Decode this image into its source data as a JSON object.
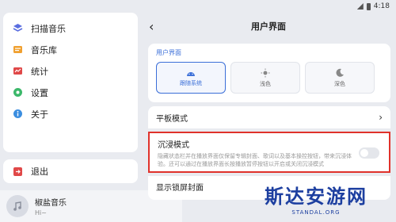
{
  "status_bar": {
    "time": "4:18"
  },
  "sidebar": {
    "items": [
      {
        "label": "扫描音乐",
        "icon": "scan-icon"
      },
      {
        "label": "音乐库",
        "icon": "library-icon"
      },
      {
        "label": "统计",
        "icon": "stats-icon"
      },
      {
        "label": "设置",
        "icon": "gear-icon"
      },
      {
        "label": "关于",
        "icon": "info-icon"
      }
    ],
    "exit_label": "退出"
  },
  "player": {
    "title": "椒盐音乐",
    "subtitle": "Hi~"
  },
  "header": {
    "title": "用户界面"
  },
  "theme_section": {
    "label": "用户界面",
    "options": [
      {
        "label": "跟随系统",
        "icon": "android-icon",
        "selected": true
      },
      {
        "label": "浅色",
        "icon": "sun-icon",
        "selected": false
      },
      {
        "label": "深色",
        "icon": "moon-icon",
        "selected": false
      }
    ]
  },
  "settings": {
    "tablet_mode": "平板模式",
    "immersive_title": "沉浸模式",
    "immersive_desc": "隐藏状态栏并在播放界面仅保留专辑封面、歌词以及基本操控按钮，带来沉浸体验。还可以通过在播放界面长按播放暂停按钮以开启或关闭沉浸模式",
    "immersive_enabled": false,
    "cover_row": "显示锁屏封面"
  },
  "watermark": {
    "cn": "斯达安游网",
    "en": "STANDAL.ORG"
  },
  "colors": {
    "accent": "#3b6fd8",
    "highlight_border": "#e0322b",
    "watermark": "#1d3fa0"
  }
}
